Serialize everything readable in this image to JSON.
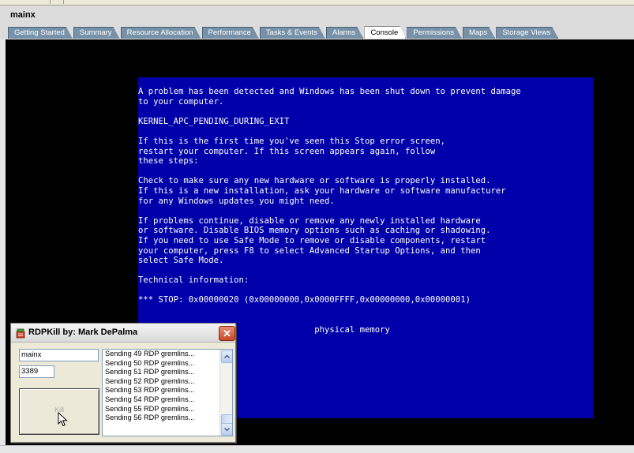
{
  "window": {
    "title": "mainx"
  },
  "tabs": [
    {
      "label": "Getting Started",
      "active": false
    },
    {
      "label": "Summary",
      "active": false
    },
    {
      "label": "Resource Allocation",
      "active": false
    },
    {
      "label": "Performance",
      "active": false
    },
    {
      "label": "Tasks & Events",
      "active": false
    },
    {
      "label": "Alarms",
      "active": false
    },
    {
      "label": "Console",
      "active": true
    },
    {
      "label": "Permissions",
      "active": false
    },
    {
      "label": "Maps",
      "active": false
    },
    {
      "label": "Storage Views",
      "active": false
    }
  ],
  "bsod": {
    "lines": [
      "A problem has been detected and Windows has been shut down to prevent damage",
      "to your computer.",
      "",
      "KERNEL_APC_PENDING_DURING_EXIT",
      "",
      "If this is the first time you've seen this Stop error screen,",
      "restart your computer. If this screen appears again, follow",
      "these steps:",
      "",
      "Check to make sure any new hardware or software is properly installed.",
      "If this is a new installation, ask your hardware or software manufacturer",
      "for any Windows updates you might need.",
      "",
      "If problems continue, disable or remove any newly installed hardware",
      "or software. Disable BIOS memory options such as caching or shadowing.",
      "If you need to use Safe Mode to remove or disable components, restart",
      "your computer, press F8 to select Advanced Startup Options, and then",
      "select Safe Mode.",
      "",
      "Technical information:",
      "",
      "*** STOP: 0x00000020 (0x00000000,0x0000FFFF,0x00000000,0x00000001)",
      "",
      "",
      "                                   physical memory"
    ]
  },
  "rdpkill": {
    "title": "RDPKill by: Mark DePalma",
    "close_glyph": "✕",
    "host_value": "mainx",
    "port_value": "3389",
    "kill_label": "Kill",
    "log": [
      "Sending 49 RDP gremlins...",
      "Sending 50 RDP gremlins...",
      "Sending 51 RDP gremlins...",
      "Sending 52 RDP gremlins...",
      "Sending 53 RDP gremlins...",
      "Sending 54 RDP gremlins...",
      "Sending 55 RDP gremlins...",
      "Sending 56 RDP gremlins..."
    ],
    "scroll_up_icon": "scroll-up-arrow-icon",
    "scroll_down_icon": "scroll-down-arrow-icon"
  },
  "colors": {
    "bsod_background": "#0000aa",
    "console_background": "#000000",
    "tab_inactive": "#7792a8",
    "close_button": "#c8492c"
  }
}
